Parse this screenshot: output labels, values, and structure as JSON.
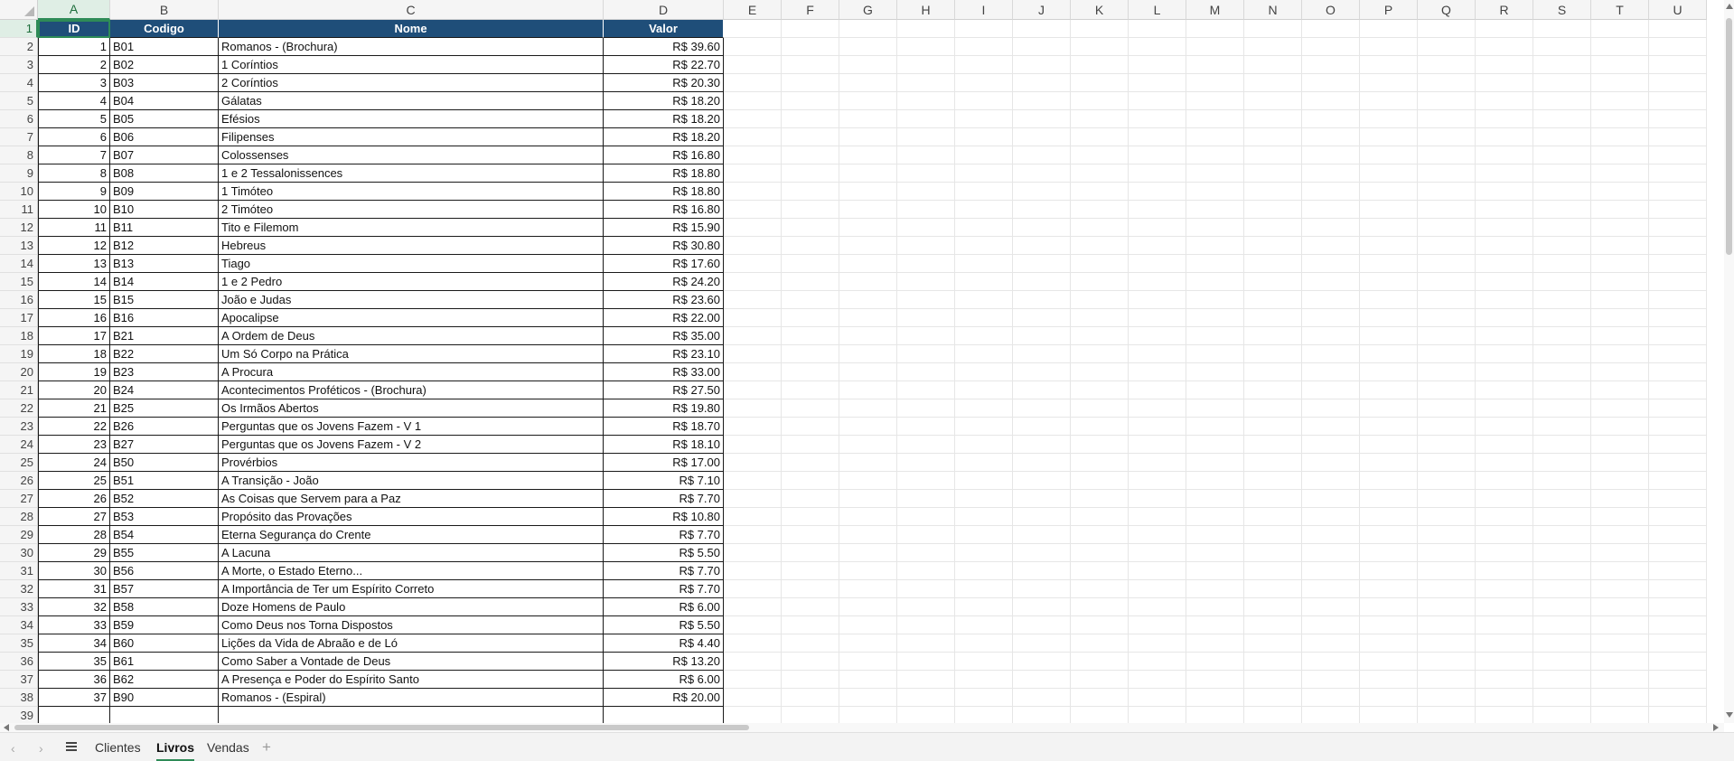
{
  "sheet": {
    "columns": [
      "A",
      "B",
      "C",
      "D",
      "E",
      "F",
      "G",
      "H",
      "I",
      "J",
      "K",
      "L",
      "M",
      "N",
      "O",
      "P",
      "Q",
      "R",
      "S",
      "T",
      "U"
    ],
    "selected_column": "A",
    "selected_row": 1,
    "headers": [
      "ID",
      "Codigo",
      "Nome",
      "Valor"
    ],
    "rows": [
      [
        "1",
        "B01",
        "Romanos - (Brochura)",
        "R$ 39.60"
      ],
      [
        "2",
        "B02",
        "1 Coríntios",
        "R$ 22.70"
      ],
      [
        "3",
        "B03",
        "2 Coríntios",
        "R$ 20.30"
      ],
      [
        "4",
        "B04",
        "Gálatas",
        "R$ 18.20"
      ],
      [
        "5",
        "B05",
        "Efésios",
        "R$ 18.20"
      ],
      [
        "6",
        "B06",
        "Filipenses",
        "R$ 18.20"
      ],
      [
        "7",
        "B07",
        "Colossenses",
        "R$ 16.80"
      ],
      [
        "8",
        "B08",
        "1 e 2 Tessalonissences",
        "R$ 18.80"
      ],
      [
        "9",
        "B09",
        "1 Timóteo",
        "R$ 18.80"
      ],
      [
        "10",
        "B10",
        "2 Timóteo",
        "R$ 16.80"
      ],
      [
        "11",
        "B11",
        "Tito e Filemom",
        "R$ 15.90"
      ],
      [
        "12",
        "B12",
        "Hebreus",
        "R$ 30.80"
      ],
      [
        "13",
        "B13",
        "Tiago",
        "R$ 17.60"
      ],
      [
        "14",
        "B14",
        "1 e 2 Pedro",
        "R$ 24.20"
      ],
      [
        "15",
        "B15",
        "João e Judas",
        "R$ 23.60"
      ],
      [
        "16",
        "B16",
        "Apocalipse",
        "R$ 22.00"
      ],
      [
        "17",
        "B21",
        "A Ordem de Deus",
        "R$ 35.00"
      ],
      [
        "18",
        "B22",
        "Um Só Corpo na Prática",
        "R$ 23.10"
      ],
      [
        "19",
        "B23",
        "A Procura",
        "R$ 33.00"
      ],
      [
        "20",
        "B24",
        "Acontecimentos Proféticos - (Brochura)",
        "R$ 27.50"
      ],
      [
        "21",
        "B25",
        "Os Irmãos Abertos",
        "R$ 19.80"
      ],
      [
        "22",
        "B26",
        "Perguntas que os Jovens Fazem - V 1",
        "R$ 18.70"
      ],
      [
        "23",
        "B27",
        "Perguntas que os Jovens Fazem - V 2",
        "R$ 18.10"
      ],
      [
        "24",
        "B50",
        "Provérbios",
        "R$ 17.00"
      ],
      [
        "25",
        "B51",
        "A Transição - João",
        "R$ 7.10"
      ],
      [
        "26",
        "B52",
        "As Coisas que Servem para a Paz",
        "R$ 7.70"
      ],
      [
        "27",
        "B53",
        "Propósito das Provações",
        "R$ 10.80"
      ],
      [
        "28",
        "B54",
        "Eterna Segurança do Crente",
        "R$ 7.70"
      ],
      [
        "29",
        "B55",
        "A Lacuna",
        "R$ 5.50"
      ],
      [
        "30",
        "B56",
        "A Morte, o Estado Eterno...",
        "R$ 7.70"
      ],
      [
        "31",
        "B57",
        "A Importância de Ter um Espírito Correto",
        "R$ 7.70"
      ],
      [
        "32",
        "B58",
        "Doze Homens de Paulo",
        "R$ 6.00"
      ],
      [
        "33",
        "B59",
        "Como Deus nos Torna Dispostos",
        "R$ 5.50"
      ],
      [
        "34",
        "B60",
        "Lições da Vida de Abraão e de Ló",
        "R$ 4.40"
      ],
      [
        "35",
        "B61",
        "Como Saber a Vontade de Deus",
        "R$ 13.20"
      ],
      [
        "36",
        "B62",
        "A Presença e Poder do Espírito Santo",
        "R$ 6.00"
      ],
      [
        "37",
        "B90",
        "Romanos - (Espiral)",
        "R$ 20.00"
      ]
    ]
  },
  "sheet_tabs": [
    {
      "label": "Clientes",
      "active": false
    },
    {
      "label": "Livros",
      "active": true
    },
    {
      "label": "Vendas",
      "active": false
    }
  ],
  "icons": {
    "prev": "chevron-left-icon",
    "next": "chevron-right-icon",
    "menu": "hamburger-menu-icon",
    "add": "plus-icon"
  },
  "colors": {
    "header_fill": "#1f4e79",
    "selection": "#2e8b57"
  }
}
